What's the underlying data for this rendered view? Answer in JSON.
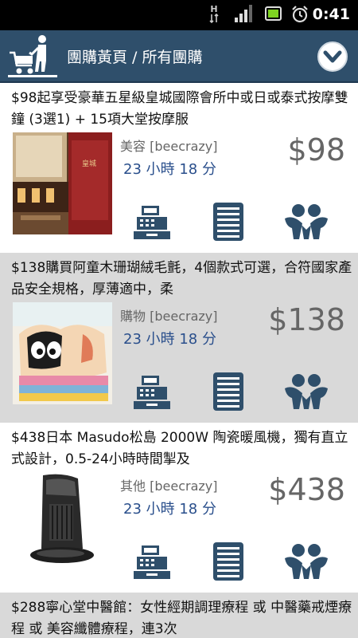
{
  "status_bar": {
    "network_type": "H",
    "time": "0:41"
  },
  "header": {
    "title": "團購黃頁 / 所有團購"
  },
  "deals": [
    {
      "title": "$98起享受豪華五星級皇城國際會所中或日或泰式按摩雙鐘 (3選1) + 15項大堂按摩服",
      "category": "美容",
      "source": "[beecrazy]",
      "time_left": "23 小時 18 分",
      "price": "$98"
    },
    {
      "title": "$138購買阿童木珊瑚絨毛氈，4個款式可選，合符國家產品安全規格，厚薄適中，柔",
      "category": "購物",
      "source": "[beecrazy]",
      "time_left": "23 小時 18 分",
      "price": "$138"
    },
    {
      "title": "$438日本 Masudo松島 2000W 陶瓷暖風機，獨有直立式設計，0.5-24小時時間掣及",
      "category": "其他",
      "source": "[beecrazy]",
      "time_left": "23 小時 18 分",
      "price": "$438"
    },
    {
      "title": "$288寧心堂中醫館：女性經期調理療程 或 中醫藥戒煙療程 或 美容纖體療程，連3次"
    }
  ],
  "colors": {
    "header_bg": "#2f4f6b",
    "icon_color": "#2f4f6b",
    "time_left_color": "#2a4f8c",
    "price_color": "#666666",
    "alt_row_bg": "#d9d9d9"
  },
  "icons": {
    "logo": "shopping-cart-person-icon",
    "dropdown": "chevron-down-circle-icon",
    "buy": "cash-register-icon",
    "detail": "list-document-icon",
    "share": "people-group-icon"
  }
}
